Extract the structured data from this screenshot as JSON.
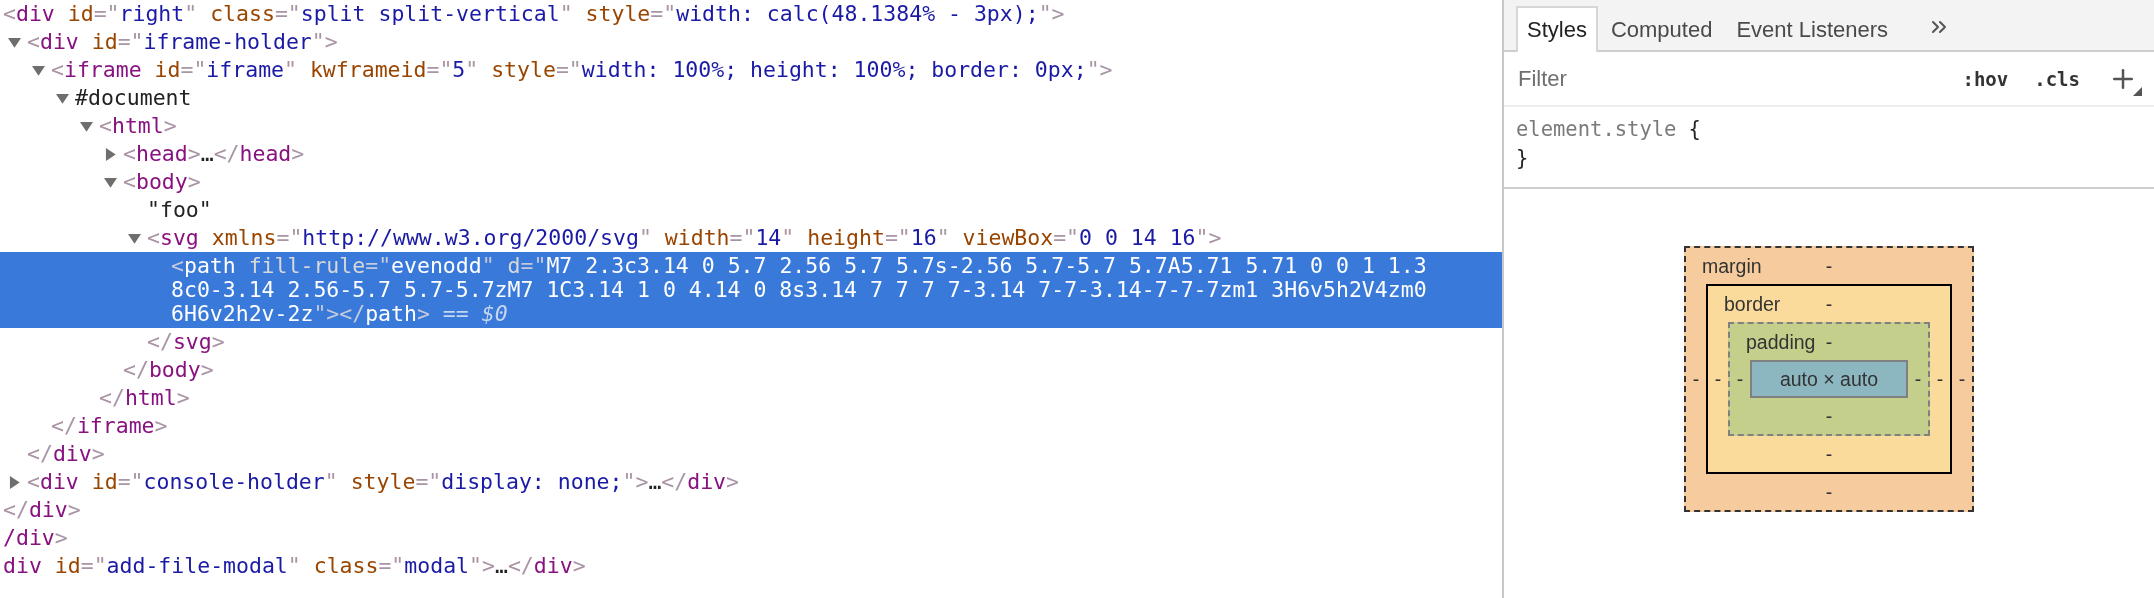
{
  "dom_tree": [
    {
      "tokens": [
        {
          "kind": "punct",
          "text": "<"
        },
        {
          "kind": "tag",
          "text": "div"
        },
        {
          "kind": "attr",
          "text": " id"
        },
        {
          "kind": "punct",
          "text": "=\""
        },
        {
          "kind": "value",
          "text": "right"
        },
        {
          "kind": "punct",
          "text": "\""
        },
        {
          "kind": "attr",
          "text": " class"
        },
        {
          "kind": "punct",
          "text": "=\""
        },
        {
          "kind": "value",
          "text": "split split-vertical"
        },
        {
          "kind": "punct",
          "text": "\""
        },
        {
          "kind": "attr",
          "text": " style"
        },
        {
          "kind": "punct",
          "text": "=\""
        },
        {
          "kind": "value",
          "text": "width: calc(48.1384% - 3px);"
        },
        {
          "kind": "punct",
          "text": "\">"
        }
      ],
      "selected": false,
      "children": [
        {
          "tokens": [
            {
              "kind": "punct",
              "text": "<"
            },
            {
              "kind": "tag",
              "text": "div"
            },
            {
              "kind": "attr",
              "text": " id"
            },
            {
              "kind": "punct",
              "text": "=\""
            },
            {
              "kind": "value",
              "text": "iframe-holder"
            },
            {
              "kind": "punct",
              "text": "\">"
            }
          ],
          "selected": false,
          "expanded": true,
          "children": [
            {
              "tokens": [
                {
                  "kind": "punct",
                  "text": "<"
                },
                {
                  "kind": "tag",
                  "text": "iframe"
                },
                {
                  "kind": "attr",
                  "text": " id"
                },
                {
                  "kind": "punct",
                  "text": "=\""
                },
                {
                  "kind": "value",
                  "text": "iframe"
                },
                {
                  "kind": "punct",
                  "text": "\""
                },
                {
                  "kind": "attr",
                  "text": " kwframeid"
                },
                {
                  "kind": "punct",
                  "text": "=\""
                },
                {
                  "kind": "value",
                  "text": "5"
                },
                {
                  "kind": "punct",
                  "text": "\""
                },
                {
                  "kind": "attr",
                  "text": " style"
                },
                {
                  "kind": "punct",
                  "text": "=\""
                },
                {
                  "kind": "value",
                  "text": "width: 100%; height: 100%; border: 0px;"
                },
                {
                  "kind": "punct",
                  "text": "\">"
                }
              ],
              "selected": false,
              "expanded": true,
              "children": [
                {
                  "tokens": [
                    {
                      "kind": "text",
                      "text": "#document"
                    }
                  ],
                  "selected": false,
                  "expanded": true,
                  "children": [
                    {
                      "tokens": [
                        {
                          "kind": "punct",
                          "text": "<"
                        },
                        {
                          "kind": "tag",
                          "text": "html"
                        },
                        {
                          "kind": "punct",
                          "text": ">"
                        }
                      ],
                      "selected": false,
                      "expanded": true,
                      "children": [
                        {
                          "tokens": [
                            {
                              "kind": "punct",
                              "text": "<"
                            },
                            {
                              "kind": "tag",
                              "text": "head"
                            },
                            {
                              "kind": "punct",
                              "text": ">"
                            },
                            {
                              "kind": "text",
                              "text": "…"
                            },
                            {
                              "kind": "punct",
                              "text": "</"
                            },
                            {
                              "kind": "tag",
                              "text": "head"
                            },
                            {
                              "kind": "punct",
                              "text": ">"
                            }
                          ],
                          "selected": false,
                          "expanded": false
                        },
                        {
                          "tokens": [
                            {
                              "kind": "punct",
                              "text": "<"
                            },
                            {
                              "kind": "tag",
                              "text": "body"
                            },
                            {
                              "kind": "punct",
                              "text": ">"
                            }
                          ],
                          "selected": false,
                          "expanded": true,
                          "children": [
                            {
                              "tokens": [
                                {
                                  "kind": "text",
                                  "text": "\"foo\""
                                }
                              ],
                              "selected": false
                            },
                            {
                              "tokens": [
                                {
                                  "kind": "punct",
                                  "text": "<"
                                },
                                {
                                  "kind": "tag",
                                  "text": "svg"
                                },
                                {
                                  "kind": "attr",
                                  "text": " xmlns"
                                },
                                {
                                  "kind": "punct",
                                  "text": "=\""
                                },
                                {
                                  "kind": "value",
                                  "text": "http://www.w3.org/2000/svg"
                                },
                                {
                                  "kind": "punct",
                                  "text": "\""
                                },
                                {
                                  "kind": "attr",
                                  "text": " width"
                                },
                                {
                                  "kind": "punct",
                                  "text": "=\""
                                },
                                {
                                  "kind": "value",
                                  "text": "14"
                                },
                                {
                                  "kind": "punct",
                                  "text": "\""
                                },
                                {
                                  "kind": "attr",
                                  "text": " height"
                                },
                                {
                                  "kind": "punct",
                                  "text": "=\""
                                },
                                {
                                  "kind": "value",
                                  "text": "16"
                                },
                                {
                                  "kind": "punct",
                                  "text": "\""
                                },
                                {
                                  "kind": "attr",
                                  "text": " viewBox"
                                },
                                {
                                  "kind": "punct",
                                  "text": "=\""
                                },
                                {
                                  "kind": "value",
                                  "text": "0 0 14 16"
                                },
                                {
                                  "kind": "punct",
                                  "text": "\">"
                                }
                              ],
                              "selected": false,
                              "expanded": true,
                              "children": [
                                {
                                  "tokens": [
                                    {
                                      "kind": "punct",
                                      "text": "<"
                                    },
                                    {
                                      "kind": "tag",
                                      "text": "path"
                                    },
                                    {
                                      "kind": "attr",
                                      "text": " fill-rule"
                                    },
                                    {
                                      "kind": "punct",
                                      "text": "=\""
                                    },
                                    {
                                      "kind": "value",
                                      "text": "evenodd"
                                    },
                                    {
                                      "kind": "punct",
                                      "text": "\""
                                    },
                                    {
                                      "kind": "attr",
                                      "text": " d"
                                    },
                                    {
                                      "kind": "punct",
                                      "text": "=\""
                                    },
                                    {
                                      "kind": "value",
                                      "text": "M7 2.3c3.14 0 5.7 2.56 5.7 5.7s-2.56 5.7-5.7 5.7A5.71 5.71 0 0 1 1.38c0-3.14 2.56-5.7 5.7-5.7zM7 1C3.14 1 0 4.14 0 8s3.14 7 7 7 7-3.14 7-7-3.14-7-7-7zm1 3H6v5h2V4zm0 6H6v2h2v-2z"
                                    },
                                    {
                                      "kind": "punct",
                                      "text": "\">"
                                    },
                                    {
                                      "kind": "punct",
                                      "text": "</"
                                    },
                                    {
                                      "kind": "tag",
                                      "text": "path"
                                    },
                                    {
                                      "kind": "punct",
                                      "text": ">"
                                    },
                                    {
                                      "kind": "marker",
                                      "text": " == "
                                    },
                                    {
                                      "kind": "variable",
                                      "text": "$0"
                                    }
                                  ],
                                  "selected": true
                                }
                              ],
                              "closing": [
                                {
                                  "kind": "punct",
                                  "text": "</"
                                },
                                {
                                  "kind": "tag",
                                  "text": "svg"
                                },
                                {
                                  "kind": "punct",
                                  "text": ">"
                                }
                              ]
                            }
                          ],
                          "closing": [
                            {
                              "kind": "punct",
                              "text": "</"
                            },
                            {
                              "kind": "tag",
                              "text": "body"
                            },
                            {
                              "kind": "punct",
                              "text": ">"
                            }
                          ]
                        }
                      ],
                      "closing": [
                        {
                          "kind": "punct",
                          "text": "</"
                        },
                        {
                          "kind": "tag",
                          "text": "html"
                        },
                        {
                          "kind": "punct",
                          "text": ">"
                        }
                      ]
                    }
                  ]
                }
              ],
              "closing": [
                {
                  "kind": "punct",
                  "text": "</"
                },
                {
                  "kind": "tag",
                  "text": "iframe"
                },
                {
                  "kind": "punct",
                  "text": ">"
                }
              ]
            }
          ],
          "closing": [
            {
              "kind": "punct",
              "text": "</"
            },
            {
              "kind": "tag",
              "text": "div"
            },
            {
              "kind": "punct",
              "text": ">"
            }
          ]
        },
        {
          "tokens": [
            {
              "kind": "punct",
              "text": "<"
            },
            {
              "kind": "tag",
              "text": "div"
            },
            {
              "kind": "attr",
              "text": " id"
            },
            {
              "kind": "punct",
              "text": "=\""
            },
            {
              "kind": "value",
              "text": "console-holder"
            },
            {
              "kind": "punct",
              "text": "\""
            },
            {
              "kind": "attr",
              "text": " style"
            },
            {
              "kind": "punct",
              "text": "=\""
            },
            {
              "kind": "value",
              "text": "display: none;"
            },
            {
              "kind": "punct",
              "text": "\">"
            },
            {
              "kind": "text",
              "text": "…"
            },
            {
              "kind": "punct",
              "text": "</"
            },
            {
              "kind": "tag",
              "text": "div"
            },
            {
              "kind": "punct",
              "text": ">"
            }
          ],
          "selected": false,
          "expanded": false
        }
      ],
      "closing": [
        {
          "kind": "punct",
          "text": "</"
        },
        {
          "kind": "tag",
          "text": "div"
        },
        {
          "kind": "punct",
          "text": ">"
        }
      ]
    },
    {
      "tokens": [
        {
          "kind": "tag",
          "text": "/div"
        },
        {
          "kind": "punct",
          "text": ">"
        }
      ],
      "selected": false
    },
    {
      "tokens": [
        {
          "kind": "tag",
          "text": "div"
        },
        {
          "kind": "attr",
          "text": " id"
        },
        {
          "kind": "punct",
          "text": "=\""
        },
        {
          "kind": "value",
          "text": "add-file-modal"
        },
        {
          "kind": "punct",
          "text": "\""
        },
        {
          "kind": "attr",
          "text": " class"
        },
        {
          "kind": "punct",
          "text": "=\""
        },
        {
          "kind": "value",
          "text": "modal"
        },
        {
          "kind": "punct",
          "text": "\">"
        },
        {
          "kind": "text",
          "text": "…"
        },
        {
          "kind": "punct",
          "text": "</"
        },
        {
          "kind": "tag",
          "text": "div"
        },
        {
          "kind": "punct",
          "text": ">"
        }
      ],
      "selected": false
    }
  ],
  "sidebar": {
    "tabs": [
      {
        "label": "Styles",
        "selected": true
      },
      {
        "label": "Computed",
        "selected": false
      },
      {
        "label": "Event Listeners",
        "selected": false
      }
    ],
    "filter": {
      "placeholder": "Filter"
    },
    "toggles": [
      ":hov",
      ".cls"
    ],
    "rules": [
      {
        "selector": "element.style",
        "open_brace": "{",
        "close_brace": "}"
      }
    ],
    "box_model": {
      "layers": [
        {
          "kind": "margin",
          "label": "margin",
          "color": "#f6cc9f",
          "top": "-"
        },
        {
          "kind": "border",
          "label": "border",
          "color": "#fadb9b",
          "top": "-"
        },
        {
          "kind": "padding",
          "label": "padding",
          "color": "#c3cf8b",
          "top": "-"
        }
      ],
      "left_values": [
        "-",
        "-",
        "-"
      ],
      "right_values": [
        "-",
        "-",
        "-"
      ],
      "bottom_values": [
        "-",
        "-",
        "-"
      ],
      "content": {
        "text": "auto × auto",
        "color": "#8cb6c0"
      }
    }
  }
}
